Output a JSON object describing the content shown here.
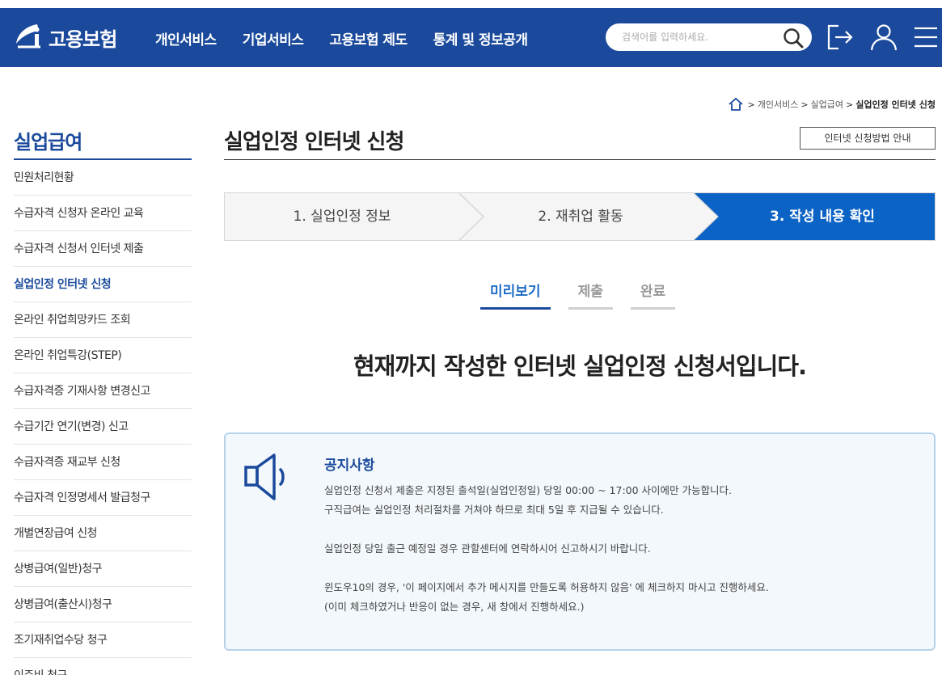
{
  "header": {
    "logo_text": "고용보험",
    "nav": [
      "개인서비스",
      "기업서비스",
      "고용보험 제도",
      "통계 및 정보공개"
    ],
    "search_placeholder": "검색어를 입력하세요."
  },
  "breadcrumb": {
    "items": [
      "개인서비스",
      "실업급여"
    ],
    "current": "실업인정 인터넷 신청"
  },
  "sidebar": {
    "title": "실업급여",
    "items": [
      "민원처리현황",
      "수급자격 신청자 온라인 교육",
      "수급자격 신청서 인터넷 제출",
      "실업인정 인터넷 신청",
      "온라인 취업희망카드 조회",
      "온라인 취업특강(STEP)",
      "수급자격증 기재사항 변경신고",
      "수급기간 연기(변경) 신고",
      "수급자격증 재교부 신청",
      "수급자격 인정명세서 발급청구",
      "개별연장급여 신청",
      "상병급여(일반)청구",
      "상병급여(출산시)청구",
      "조기재취업수당 청구",
      "이주비 청구"
    ],
    "active_index": 3
  },
  "main": {
    "title": "실업인정 인터넷 신청",
    "guide_button": "인터넷 신청방법 안내",
    "steps": [
      "1. 실업인정 정보",
      "2. 재취업 활동",
      "3. 작성 내용 확인"
    ],
    "active_step": 3,
    "tabs": [
      "미리보기",
      "제출",
      "완료"
    ],
    "active_tab": 1,
    "headline": "현재까지 작성한 인터넷 실업인정 신청서입니다."
  },
  "notice": {
    "title": "공지사항",
    "lines": [
      "실업인정 신청서 제출은 지정된 출석일(실업인정일) 당일 00:00 ~ 17:00 사이에만 가능합니다.",
      "구직급여는 실업인정 처리절차를 거쳐야 하므로 최대 5일 후 지급될 수 있습니다.",
      "실업인정 당일 출근 예정일 경우 관할센터에 연락하시어 신고하시기 바랍니다.",
      "윈도우10의 경우, '이 페이지에서 추가 메시지를 만들도록 허용하지 않음' 에 체크하지 마시고 진행하세요.",
      "(이미 체크하였거나 반응이 없는 경우, 새 창에서 진행하세요.)"
    ]
  },
  "colors": {
    "brand": "#1b4a9c",
    "step_active": "#0b63c5",
    "notice_border": "#b7d3ea",
    "notice_bg": "#f3f8fc"
  }
}
